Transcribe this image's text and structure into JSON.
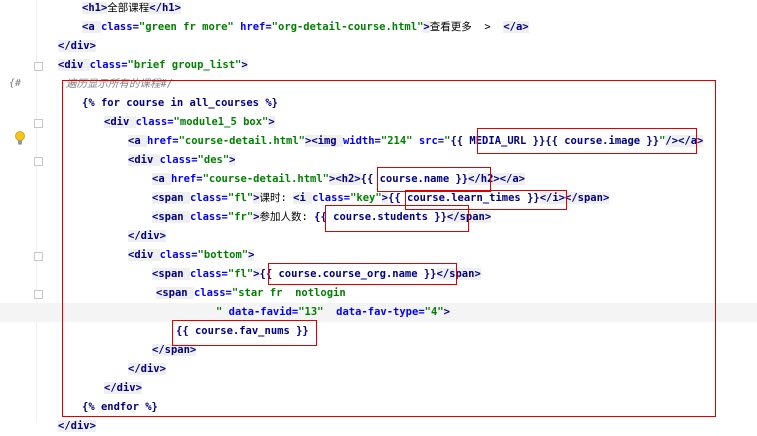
{
  "editor": {
    "gutter_comment_mark": "{#",
    "lines": [
      [
        {
          "c": "tag",
          "t": "<h1>"
        },
        {
          "c": "plain",
          "t": "全部课程"
        },
        {
          "c": "tag",
          "t": "</h1>"
        }
      ],
      [
        {
          "c": "tag",
          "t": "<a "
        },
        {
          "c": "attr",
          "t": "class="
        },
        {
          "c": "str",
          "t": "\"green fr more\" "
        },
        {
          "c": "attr",
          "t": "href="
        },
        {
          "c": "str",
          "t": "\"org-detail-course.html\""
        },
        {
          "c": "tag",
          "t": ">"
        },
        {
          "c": "plain",
          "t": "查看更多  >  "
        },
        {
          "c": "tag",
          "t": "</a>"
        }
      ],
      [
        {
          "c": "tag",
          "t": "</div>"
        }
      ],
      [
        {
          "c": "tag",
          "t": "<div "
        },
        {
          "c": "attr",
          "t": "class="
        },
        {
          "c": "str",
          "t": "\"brief group_list\""
        },
        {
          "c": "tag",
          "t": ">"
        }
      ],
      [
        {
          "c": "cmt",
          "t": "遍历显示所有的课程#/"
        }
      ],
      [
        {
          "c": "tplkw",
          "t": "{% for course in all_courses %}"
        }
      ],
      [
        {
          "c": "tag",
          "t": "<div "
        },
        {
          "c": "attr",
          "t": "class="
        },
        {
          "c": "str",
          "t": "\"module1_5 box\""
        },
        {
          "c": "tag",
          "t": ">"
        }
      ],
      [
        {
          "c": "tag",
          "t": "<a "
        },
        {
          "c": "attr",
          "t": "href="
        },
        {
          "c": "str",
          "t": "\"course-detail.html\""
        },
        {
          "c": "tag",
          "t": ">"
        },
        {
          "c": "tag",
          "t": "<img "
        },
        {
          "c": "attr",
          "t": "width="
        },
        {
          "c": "str",
          "t": "\"214\" "
        },
        {
          "c": "attr",
          "t": "src="
        },
        {
          "c": "str",
          "t": "\""
        },
        {
          "c": "tpl",
          "t": "{{ MEDIA_URL }}{{ course.image }}"
        },
        {
          "c": "str",
          "t": "\""
        },
        {
          "c": "tag",
          "t": "/>"
        },
        {
          "c": "tag",
          "t": "</a>"
        }
      ],
      [
        {
          "c": "tag",
          "t": "<div "
        },
        {
          "c": "attr",
          "t": "class="
        },
        {
          "c": "str",
          "t": "\"des\""
        },
        {
          "c": "tag",
          "t": ">"
        }
      ],
      [
        {
          "c": "tag",
          "t": "<a "
        },
        {
          "c": "attr",
          "t": "href="
        },
        {
          "c": "str",
          "t": "\"course-detail.html\""
        },
        {
          "c": "tag",
          "t": ">"
        },
        {
          "c": "tag",
          "t": "<h2>"
        },
        {
          "c": "tpl",
          "t": "{{ course.name }}"
        },
        {
          "c": "tag",
          "t": "</h2>"
        },
        {
          "c": "tag",
          "t": "</a>"
        }
      ],
      [
        {
          "c": "tag",
          "t": "<span "
        },
        {
          "c": "attr",
          "t": "class="
        },
        {
          "c": "str",
          "t": "\"fl\""
        },
        {
          "c": "tag",
          "t": ">"
        },
        {
          "c": "plain",
          "t": "课时: "
        },
        {
          "c": "tag",
          "t": "<i "
        },
        {
          "c": "attr",
          "t": "class="
        },
        {
          "c": "str",
          "t": "\"key\""
        },
        {
          "c": "tag",
          "t": ">"
        },
        {
          "c": "tpl",
          "t": "{{ course.learn_times }}"
        },
        {
          "c": "tag",
          "t": "</i>"
        },
        {
          "c": "tag",
          "t": "</span>"
        }
      ],
      [
        {
          "c": "tag",
          "t": "<span "
        },
        {
          "c": "attr",
          "t": "class="
        },
        {
          "c": "str",
          "t": "\"fr\""
        },
        {
          "c": "tag",
          "t": ">"
        },
        {
          "c": "plain",
          "t": "参加人数: "
        },
        {
          "c": "tpl",
          "t": "{{ course.students }}"
        },
        {
          "c": "tag",
          "t": "</span>"
        }
      ],
      [
        {
          "c": "tag",
          "t": "</div>"
        }
      ],
      [
        {
          "c": "tag",
          "t": "<div "
        },
        {
          "c": "attr",
          "t": "class="
        },
        {
          "c": "str",
          "t": "\"bottom\""
        },
        {
          "c": "tag",
          "t": ">"
        }
      ],
      [
        {
          "c": "tag",
          "t": "<span "
        },
        {
          "c": "attr",
          "t": "class="
        },
        {
          "c": "str",
          "t": "\"fl\""
        },
        {
          "c": "tag",
          "t": ">"
        },
        {
          "c": "tpl",
          "t": "{{ course.course_org.name }}"
        },
        {
          "c": "tag",
          "t": "</span>"
        }
      ],
      [
        {
          "c": "tag",
          "t": "<span "
        },
        {
          "c": "attr",
          "t": "class="
        },
        {
          "c": "str",
          "t": "\"star fr  notlogin"
        }
      ],
      [
        {
          "c": "str",
          "t": "\" "
        },
        {
          "c": "attr",
          "t": "data-favid="
        },
        {
          "c": "str",
          "t": "\"13\"  "
        },
        {
          "c": "attr",
          "t": "data-fav-type="
        },
        {
          "c": "str",
          "t": "\"4\""
        },
        {
          "c": "tag",
          "t": ">"
        }
      ],
      [
        {
          "c": "tpl",
          "t": "{{ course.fav_nums }}"
        }
      ],
      [
        {
          "c": "tag",
          "t": "</span>"
        }
      ],
      [
        {
          "c": "tag",
          "t": "</div>"
        }
      ],
      [
        {
          "c": "tag",
          "t": "</div>"
        }
      ],
      [
        {
          "c": "tplkw",
          "t": "{% endfor %}"
        }
      ],
      [
        {
          "c": "tag",
          "t": "</div>"
        }
      ]
    ]
  }
}
